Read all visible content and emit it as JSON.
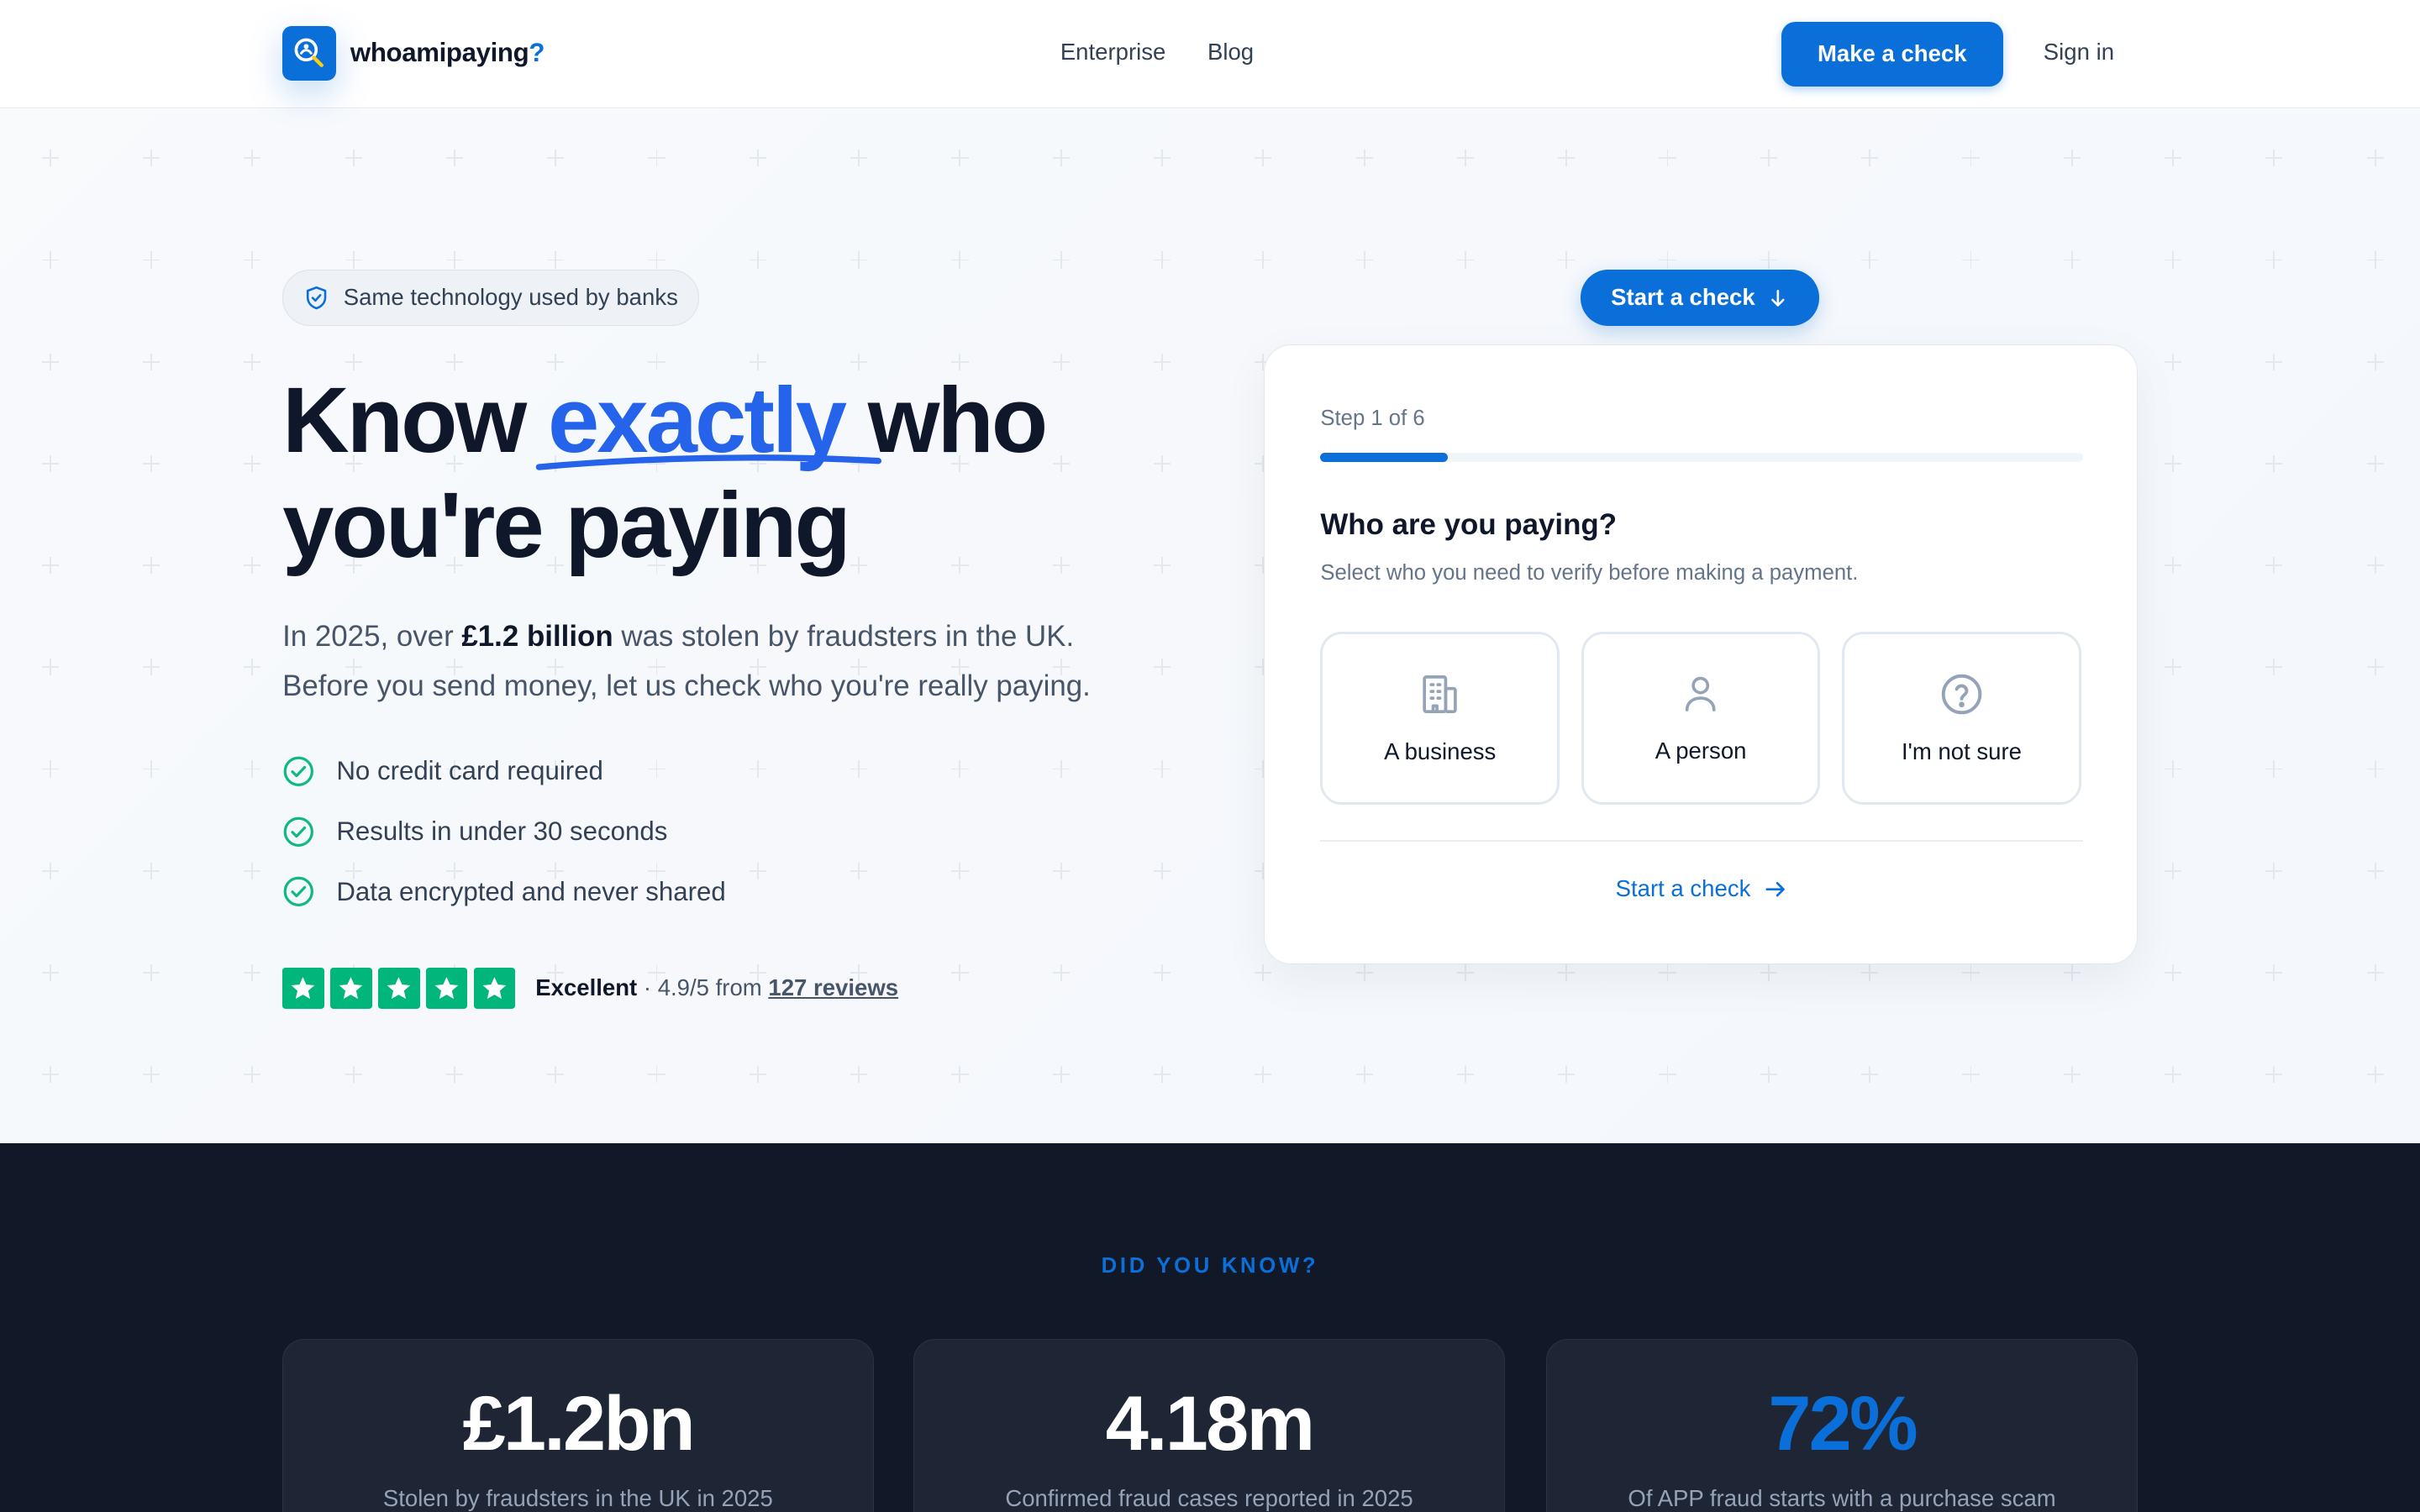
{
  "header": {
    "brand_name": "whoamipaying",
    "brand_suffix": "?",
    "nav": [
      "Enterprise",
      "Blog"
    ],
    "cta_label": "Make a check",
    "signin_label": "Sign in"
  },
  "hero": {
    "badge": "Same technology used by banks",
    "headline_part1": "Know ",
    "headline_accent": "exactly",
    "headline_part2": " who",
    "headline_line2": "you're paying",
    "sub_part1": "In 2025, over ",
    "sub_bold": "£1.2 billion",
    "sub_part2": " was stolen by fraudsters in the UK.",
    "sub_line2": "Before you send money, let us check who you're really paying.",
    "checks": [
      "No credit card required",
      "Results in under 30 seconds",
      "Data encrypted and never shared"
    ],
    "rating_label": "Excellent",
    "rating_score": " · 4.9/5 from ",
    "rating_link": "127 reviews",
    "stars": 5
  },
  "check_card": {
    "pill_label": "Start a check",
    "step_label": "Step 1 of 6",
    "progress": 0.1667,
    "question": "Who are you paying?",
    "subtitle": "Select who you need to verify before making a payment.",
    "options": [
      {
        "label": "A business",
        "icon": "building-icon"
      },
      {
        "label": "A person",
        "icon": "person-icon"
      },
      {
        "label": "I'm not sure",
        "icon": "question-icon"
      }
    ],
    "link_label": "Start a check"
  },
  "stats": {
    "heading": "DID YOU KNOW?",
    "items": [
      {
        "value": "£1.2bn",
        "label": "Stolen by fraudsters in the UK in 2025"
      },
      {
        "value": "4.18m",
        "label": "Confirmed fraud cases reported in 2025"
      },
      {
        "value": "72%",
        "label": "Of APP fraud starts with a purchase scam"
      }
    ]
  },
  "colors": {
    "brand": "#0b6fd9",
    "accent_text": "#2563eb",
    "success": "#00b67a",
    "dark_bg": "#111827"
  }
}
